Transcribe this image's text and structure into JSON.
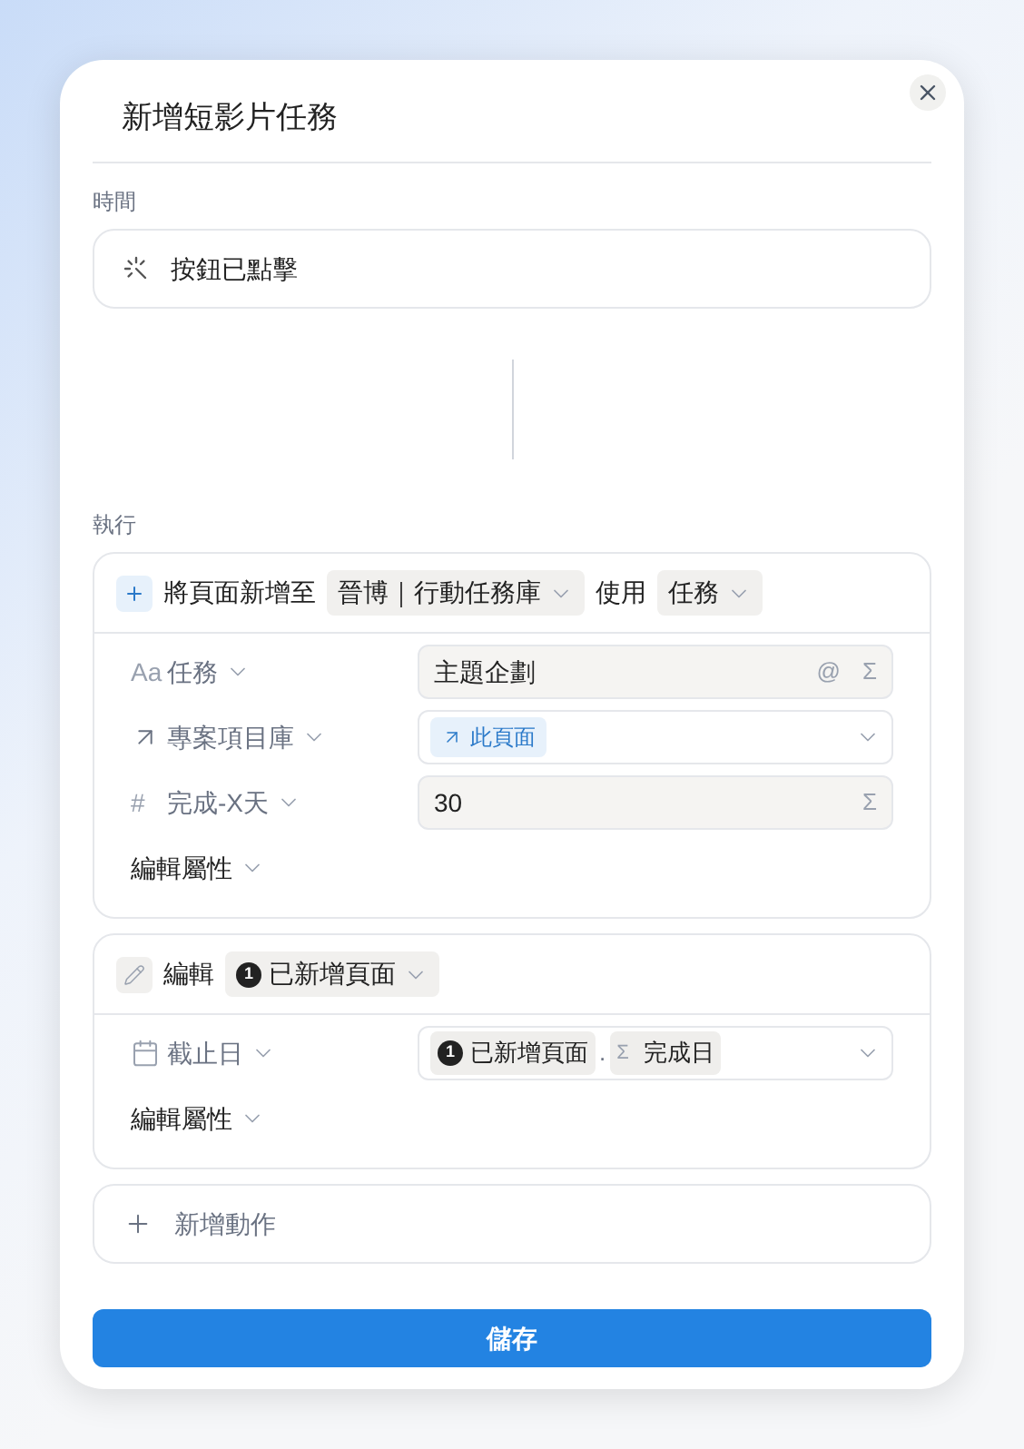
{
  "dialog": {
    "title": "新增短影片任務"
  },
  "trigger": {
    "label": "時間",
    "text": "按鈕已點擊"
  },
  "actions_label": "執行",
  "actions": [
    {
      "kind": "add_page",
      "verb": "將頁面新增至",
      "database": "晉博｜行動任務庫",
      "joiner": "使用",
      "template": "任務",
      "edit_props": "編輯屬性",
      "properties": [
        {
          "kind": "title",
          "glyph": "Aa",
          "name": "任務",
          "value": {
            "kind": "text",
            "text": "主題企劃",
            "tools": [
              "@",
              "Σ"
            ]
          }
        },
        {
          "kind": "relation",
          "name": "專案項目庫",
          "value": {
            "kind": "page",
            "text": "此頁面"
          }
        },
        {
          "kind": "number",
          "glyph": "#",
          "name": "完成-X天",
          "value": {
            "kind": "text",
            "text": "30",
            "tools": [
              "Σ"
            ]
          }
        }
      ]
    },
    {
      "kind": "edit",
      "verb": "編輯",
      "target_number": "1",
      "target": "已新增頁面",
      "edit_props": "編輯屬性",
      "properties": [
        {
          "kind": "date",
          "name": "截止日",
          "value": {
            "kind": "reference",
            "number": "1",
            "page": "已新增頁面",
            "separator": ".",
            "sigma": "Σ",
            "field": "完成日"
          }
        }
      ]
    }
  ],
  "add_action": "新增動作",
  "save": "儲存"
}
